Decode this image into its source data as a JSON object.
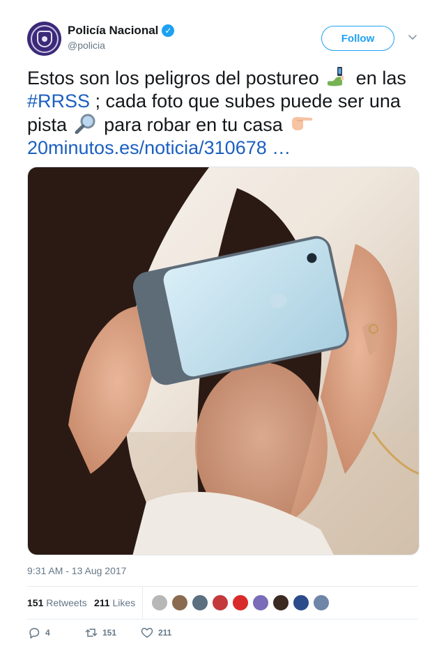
{
  "author": {
    "display_name": "Policía Nacional",
    "handle": "@policia",
    "verified_icon": "verified-badge-icon",
    "avatar_icon": "police-shield-icon"
  },
  "header": {
    "follow_label": "Follow",
    "menu_icon": "chevron-down-icon"
  },
  "tweet": {
    "text_1": "Estos son los peligros del postureo",
    "text_2": " en las ",
    "hashtag": "#RRSS",
    "text_3": "; cada foto que subes puede ser una pista",
    "text_4": " para robar en tu casa",
    "link": "20minutos.es/noticia/310678",
    "link_ellipsis": "…",
    "emojis": [
      "selfie-emoji",
      "magnifying-glass-emoji",
      "pointing-finger-emoji"
    ]
  },
  "media": {
    "icon": "selfie-photo-image"
  },
  "timestamp": "9:31 AM - 13 Aug 2017",
  "stats": {
    "retweets_count": "151",
    "retweets_label": "Retweets",
    "likes_count": "211",
    "likes_label": "Likes"
  },
  "likers": [
    "#b7b7b7",
    "#8a6b4f",
    "#5a6f80",
    "#c43a3a",
    "#d92a2a",
    "#7a6cb8",
    "#3a2a22",
    "#2a4c8a",
    "#6f86a8"
  ],
  "actions": {
    "replies_count": "4",
    "retweets_count": "151",
    "likes_count": "211"
  },
  "colors": {
    "accent": "#1da1f2",
    "link": "#1b5fc1",
    "muted": "#657786"
  }
}
